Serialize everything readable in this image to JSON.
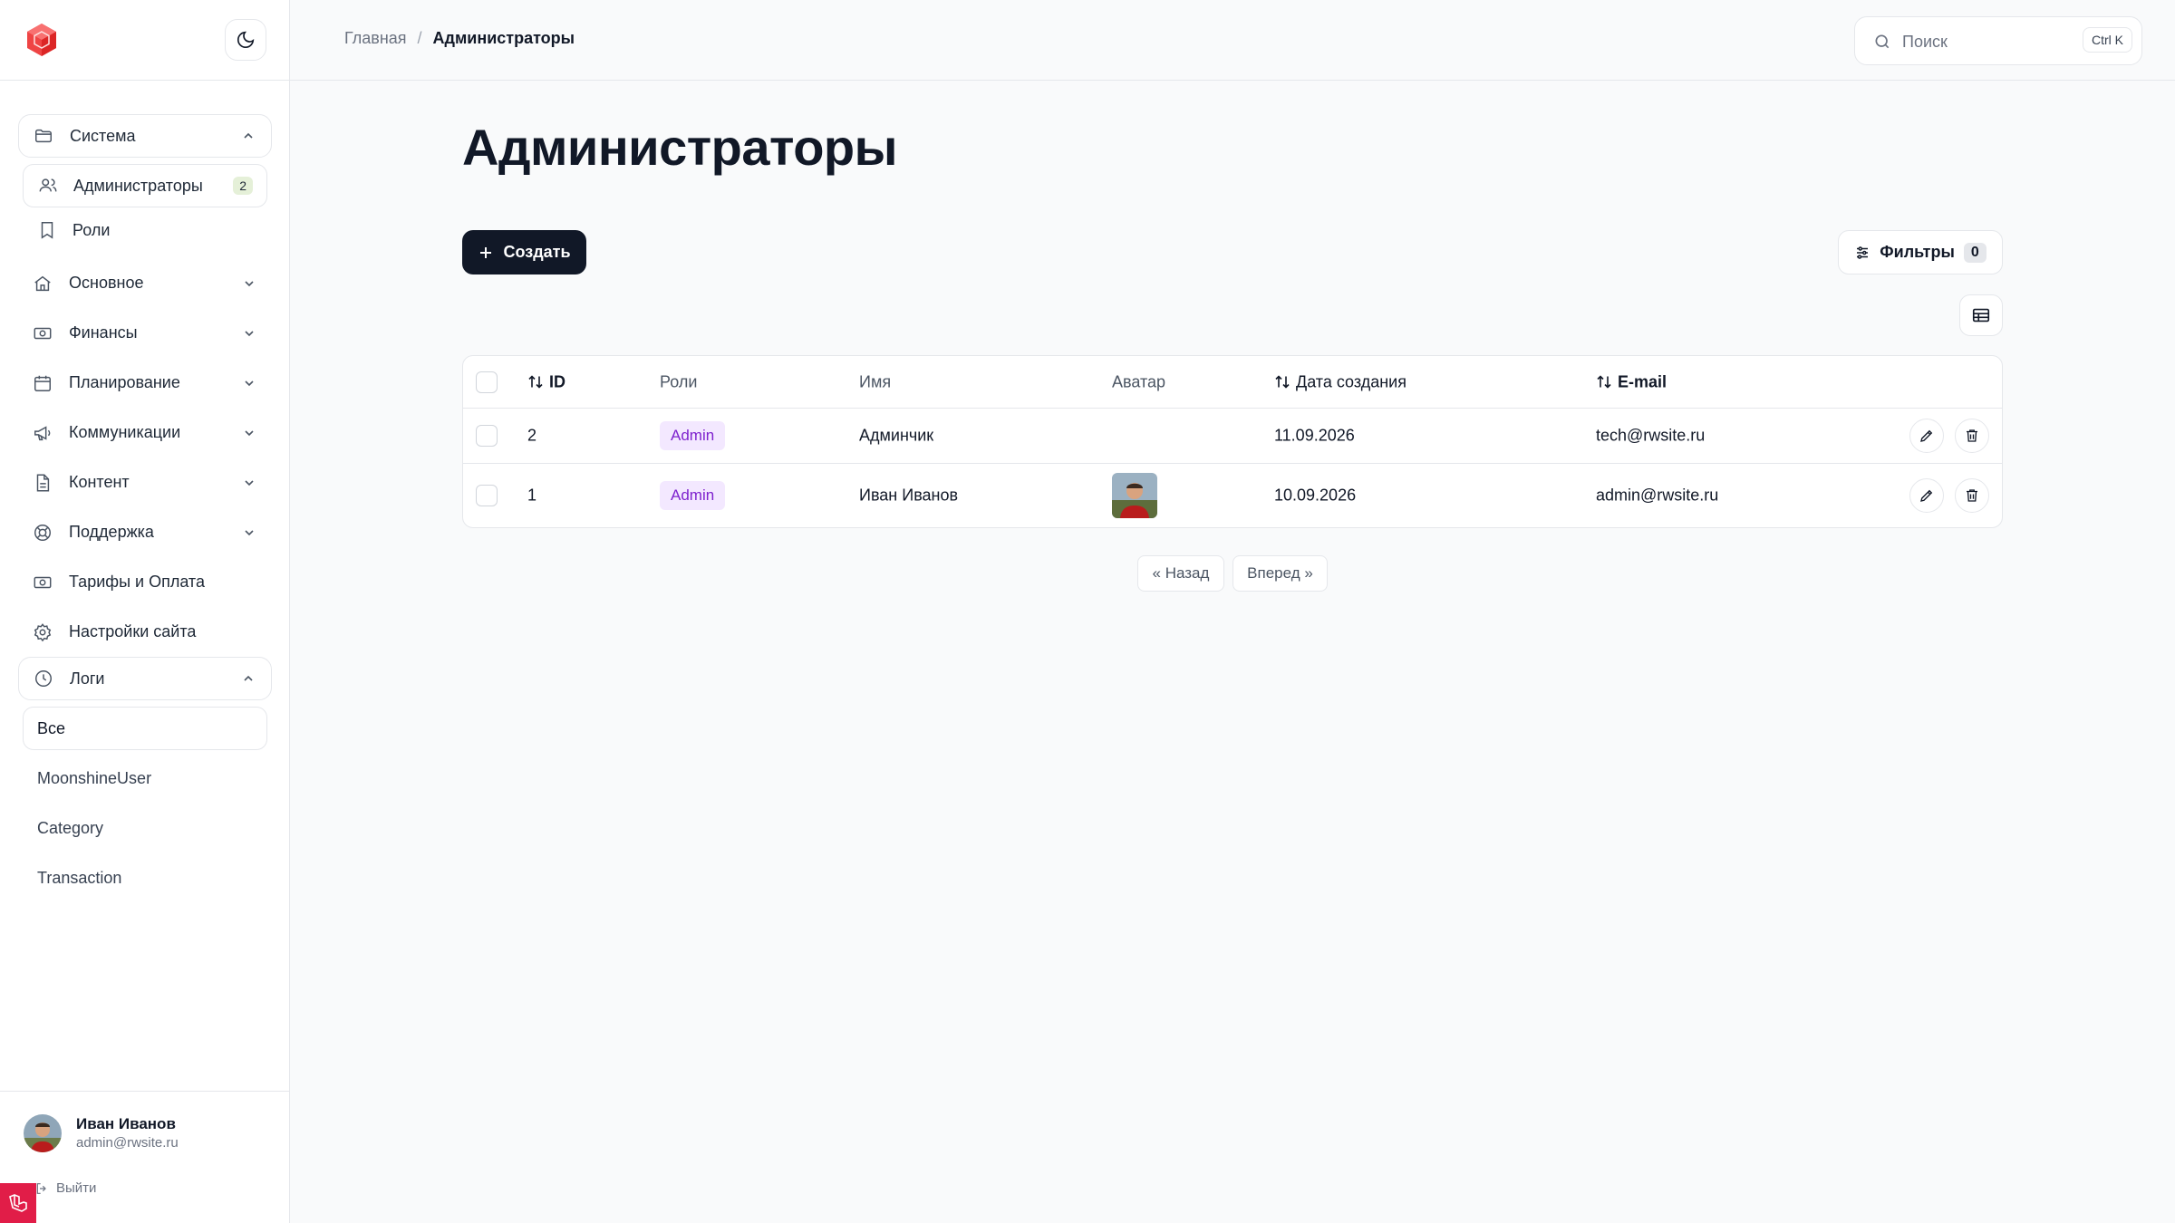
{
  "sidebar": {
    "groups": [
      {
        "label": "Система",
        "icon": "folder-icon",
        "open": true
      },
      {
        "label": "Основное",
        "icon": "home-icon"
      },
      {
        "label": "Финансы",
        "icon": "banknote-icon"
      },
      {
        "label": "Планирование",
        "icon": "calendar-icon"
      },
      {
        "label": "Коммуникации",
        "icon": "megaphone-icon"
      },
      {
        "label": "Контент",
        "icon": "document-icon"
      },
      {
        "label": "Поддержка",
        "icon": "lifebuoy-icon"
      },
      {
        "label": "Тарифы и Оплата",
        "icon": "banknote-icon"
      },
      {
        "label": "Настройки сайта",
        "icon": "gear-icon"
      },
      {
        "label": "Логи",
        "icon": "clock-icon",
        "open": true
      }
    ],
    "system_items": [
      {
        "label": "Администраторы",
        "badge": "2",
        "icon": "users-icon"
      },
      {
        "label": "Роли",
        "icon": "bookmark-icon"
      }
    ],
    "log_items": [
      {
        "label": "Все"
      },
      {
        "label": "MoonshineUser"
      },
      {
        "label": "Category"
      },
      {
        "label": "Transaction"
      }
    ],
    "user": {
      "name": "Иван Иванов",
      "email": "admin@rwsite.ru",
      "logout": "Выйти"
    }
  },
  "topbar": {
    "breadcrumb_home": "Главная",
    "breadcrumb_sep": "/",
    "breadcrumb_current": "Администраторы",
    "search_placeholder": "Поиск",
    "search_shortcut": "Ctrl K"
  },
  "main": {
    "title": "Администраторы",
    "create_label": "Создать",
    "filters_label": "Фильтры",
    "filters_count": "0",
    "columns": [
      "ID",
      "Роли",
      "Имя",
      "Аватар",
      "Дата создания",
      "E-mail"
    ],
    "rows": [
      {
        "id": "2",
        "role": "Admin",
        "name": "Админчик",
        "has_avatar": false,
        "date": "11.09.2026",
        "email": "tech@rwsite.ru"
      },
      {
        "id": "1",
        "role": "Admin",
        "name": "Иван Иванов",
        "has_avatar": true,
        "date": "10.09.2026",
        "email": "admin@rwsite.ru"
      }
    ],
    "pager_prev": "« Назад",
    "pager_next": "Вперед »"
  },
  "colors": {
    "accent": "#111827",
    "brand": "#ef4444",
    "role_bg": "#f3e8ff",
    "role_text": "#7e22ce"
  }
}
